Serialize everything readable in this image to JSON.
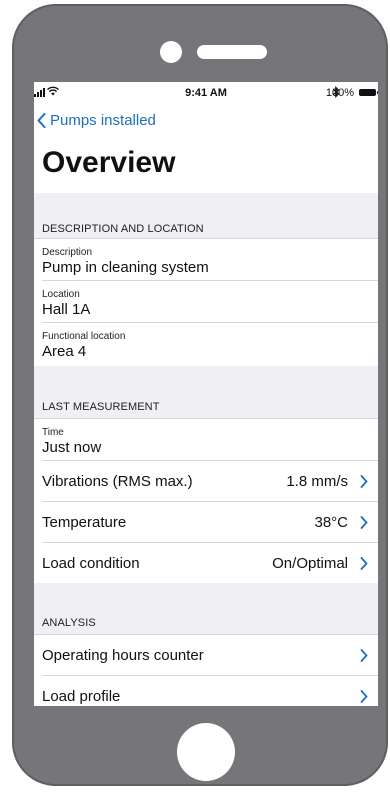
{
  "status_bar": {
    "time": "9:41 AM",
    "battery_text": "100%",
    "bluetooth_icon": "bluetooth-icon",
    "wifi_icon": "wifi-icon"
  },
  "nav": {
    "back_label": "Pumps installed",
    "title": "Overview"
  },
  "sections": {
    "description": {
      "header": "DESCRIPTION AND LOCATION",
      "items": [
        {
          "label": "Description",
          "value": "Pump in cleaning system"
        },
        {
          "label": "Location",
          "value": "Hall 1A"
        },
        {
          "label": "Functional location",
          "value": "Area 4"
        }
      ]
    },
    "measurement": {
      "header": "LAST MEASUREMENT",
      "time_label": "Time",
      "time_value": "Just now",
      "rows": [
        {
          "label": "Vibrations (RMS max.)",
          "value": "1.8 mm/s"
        },
        {
          "label": "Temperature",
          "value": "38°C"
        },
        {
          "label": "Load condition",
          "value": "On/Optimal"
        }
      ]
    },
    "analysis": {
      "header": "ANALYSIS",
      "rows": [
        {
          "label": "Operating hours counter"
        },
        {
          "label": "Load profile"
        }
      ]
    }
  },
  "colors": {
    "accent": "#1d6fbe",
    "phone_body": "#76767a",
    "section_background": "#efeff4"
  }
}
